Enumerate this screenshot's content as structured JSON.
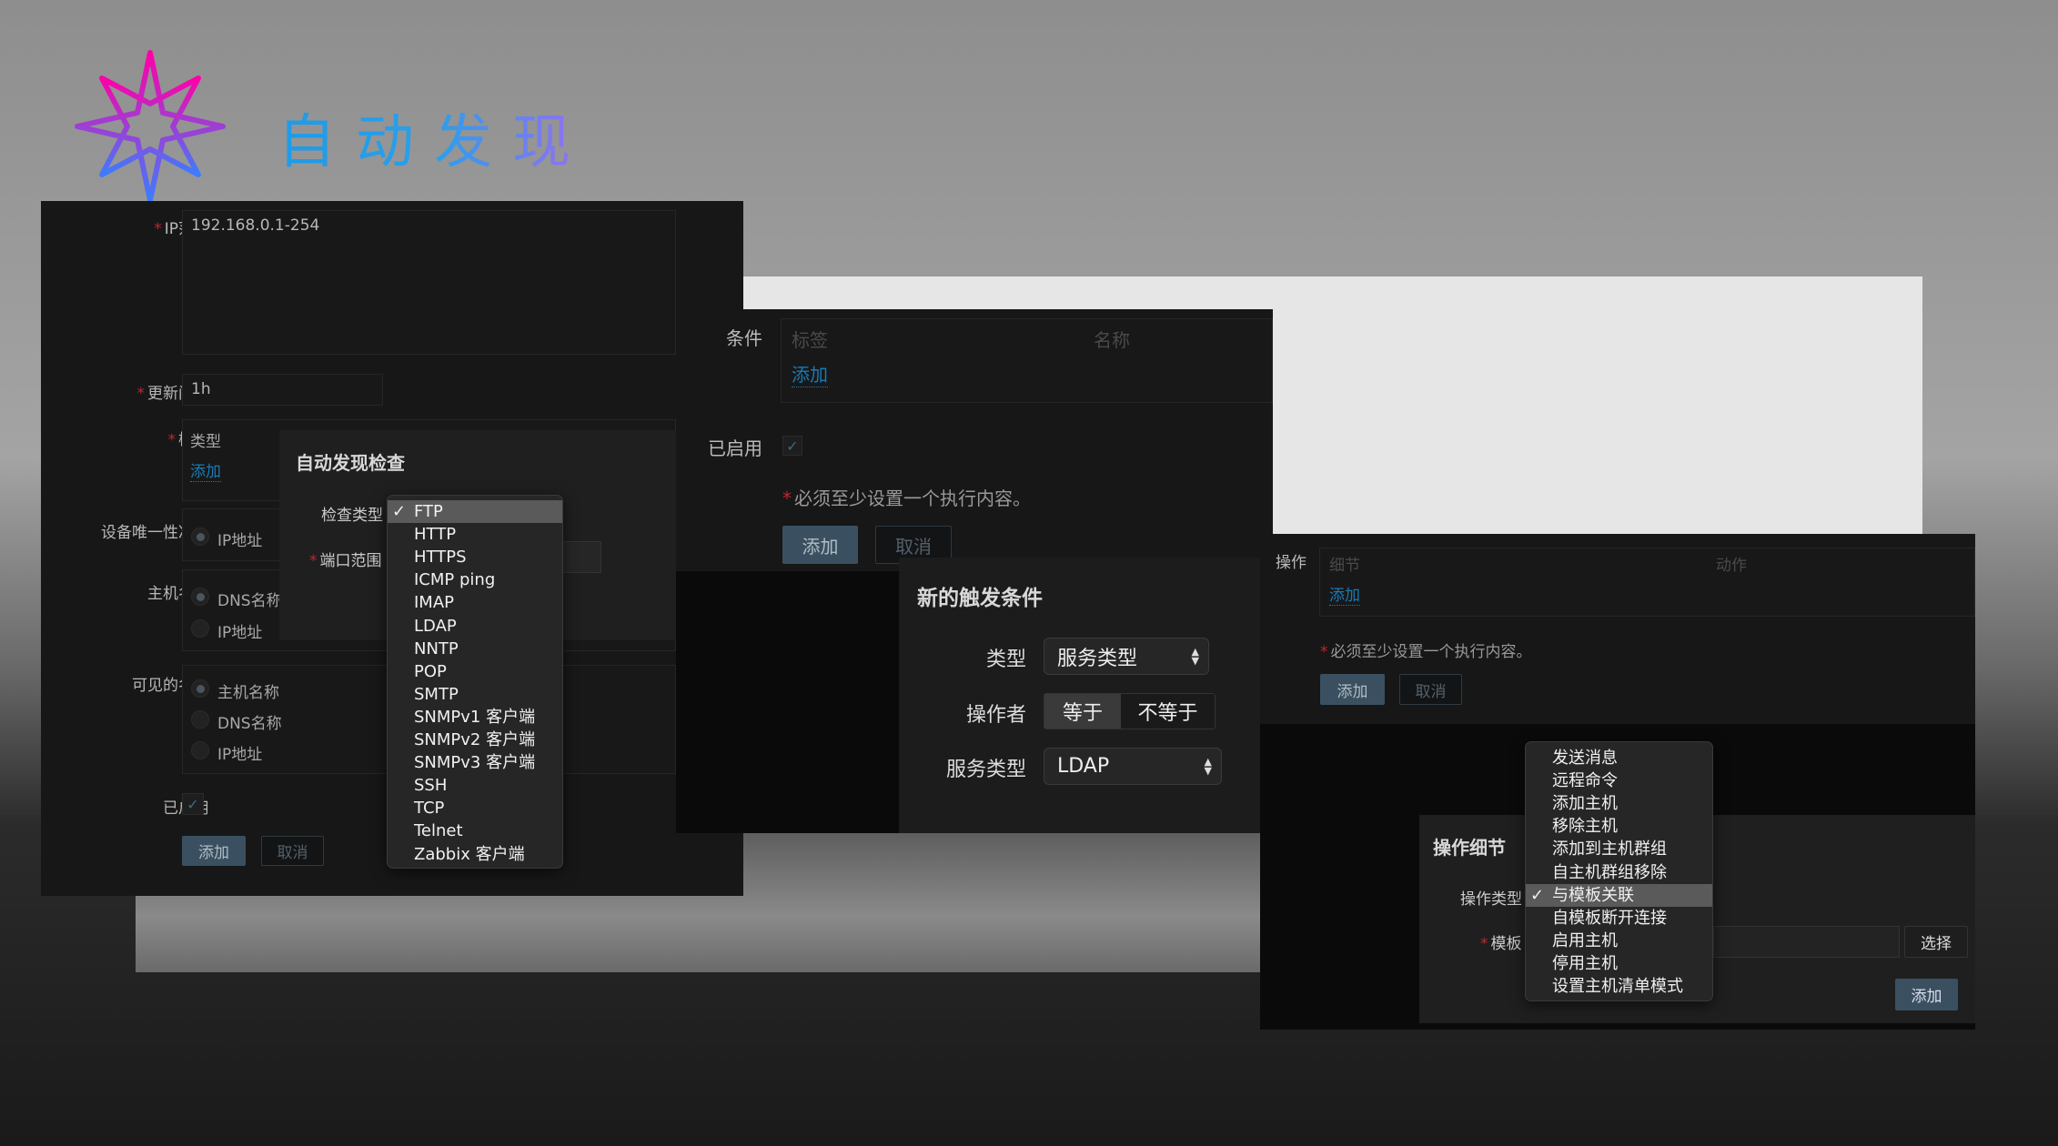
{
  "header": {
    "title": "自动发现",
    "logo_icon": "compass-star-icon"
  },
  "discovery_form": {
    "ip_range_label": "IP范围",
    "ip_range_value": "192.168.0.1-254",
    "interval_label": "更新间隔",
    "interval_value": "1h",
    "checks_label": "检查",
    "checks_col_type": "类型",
    "checks_add": "添加",
    "uniqueness_label": "设备唯一性准则",
    "uniqueness_options": [
      "IP地址"
    ],
    "hostname_label": "主机名称",
    "hostname_options": [
      "DNS名称",
      "IP地址"
    ],
    "visible_name_label": "可见的名称",
    "visible_name_options": [
      "主机名称",
      "DNS名称",
      "IP地址"
    ],
    "enabled_label": "已启用",
    "add_button": "添加",
    "cancel_button": "取消"
  },
  "check_dialog": {
    "title": "自动发现检查",
    "type_label": "检查类型",
    "port_label": "端口范围",
    "selected": "FTP",
    "options": [
      "FTP",
      "HTTP",
      "HTTPS",
      "ICMP ping",
      "IMAP",
      "LDAP",
      "NNTP",
      "POP",
      "SMTP",
      "SNMPv1 客户端",
      "SNMPv2 客户端",
      "SNMPv3 客户端",
      "SSH",
      "TCP",
      "Telnet",
      "Zabbix 客户端"
    ]
  },
  "action_form": {
    "conditions_label": "条件",
    "col_label": "标签",
    "col_name": "名称",
    "add_link": "添加",
    "enabled_label": "已启用",
    "warning": "必须至少设置一个执行内容。",
    "add_button": "添加",
    "cancel_button": "取消"
  },
  "trigger_dialog": {
    "title": "新的触发条件",
    "type_label": "类型",
    "type_value": "服务类型",
    "operator_label": "操作者",
    "operator_options": [
      "等于",
      "不等于"
    ],
    "operator_selected": "等于",
    "service_label": "服务类型",
    "service_value": "LDAP"
  },
  "operations_form": {
    "operations_label": "操作",
    "col_details": "细节",
    "col_action": "动作",
    "add_link": "添加",
    "warning": "必须至少设置一个执行内容。",
    "add_button": "添加",
    "cancel_button": "取消"
  },
  "operation_dialog": {
    "title": "操作细节",
    "type_label": "操作类型",
    "template_label": "模板",
    "select_button": "选择",
    "add_button": "添加",
    "selected": "与模板关联",
    "options": [
      "发送消息",
      "远程命令",
      "添加主机",
      "移除主机",
      "添加到主机群组",
      "自主机群组移除",
      "与模板关联",
      "自模板断开连接",
      "启用主机",
      "停用主机",
      "设置主机清单模式"
    ]
  },
  "colors": {
    "accent_link": "#1a7ab5",
    "primary_button": "#3a5060",
    "required": "#c0262d",
    "title_gradient": [
      "#1e9be8",
      "#9b6cf0"
    ],
    "logo_gradient": [
      "#ff00a8",
      "#3d7cff"
    ]
  }
}
